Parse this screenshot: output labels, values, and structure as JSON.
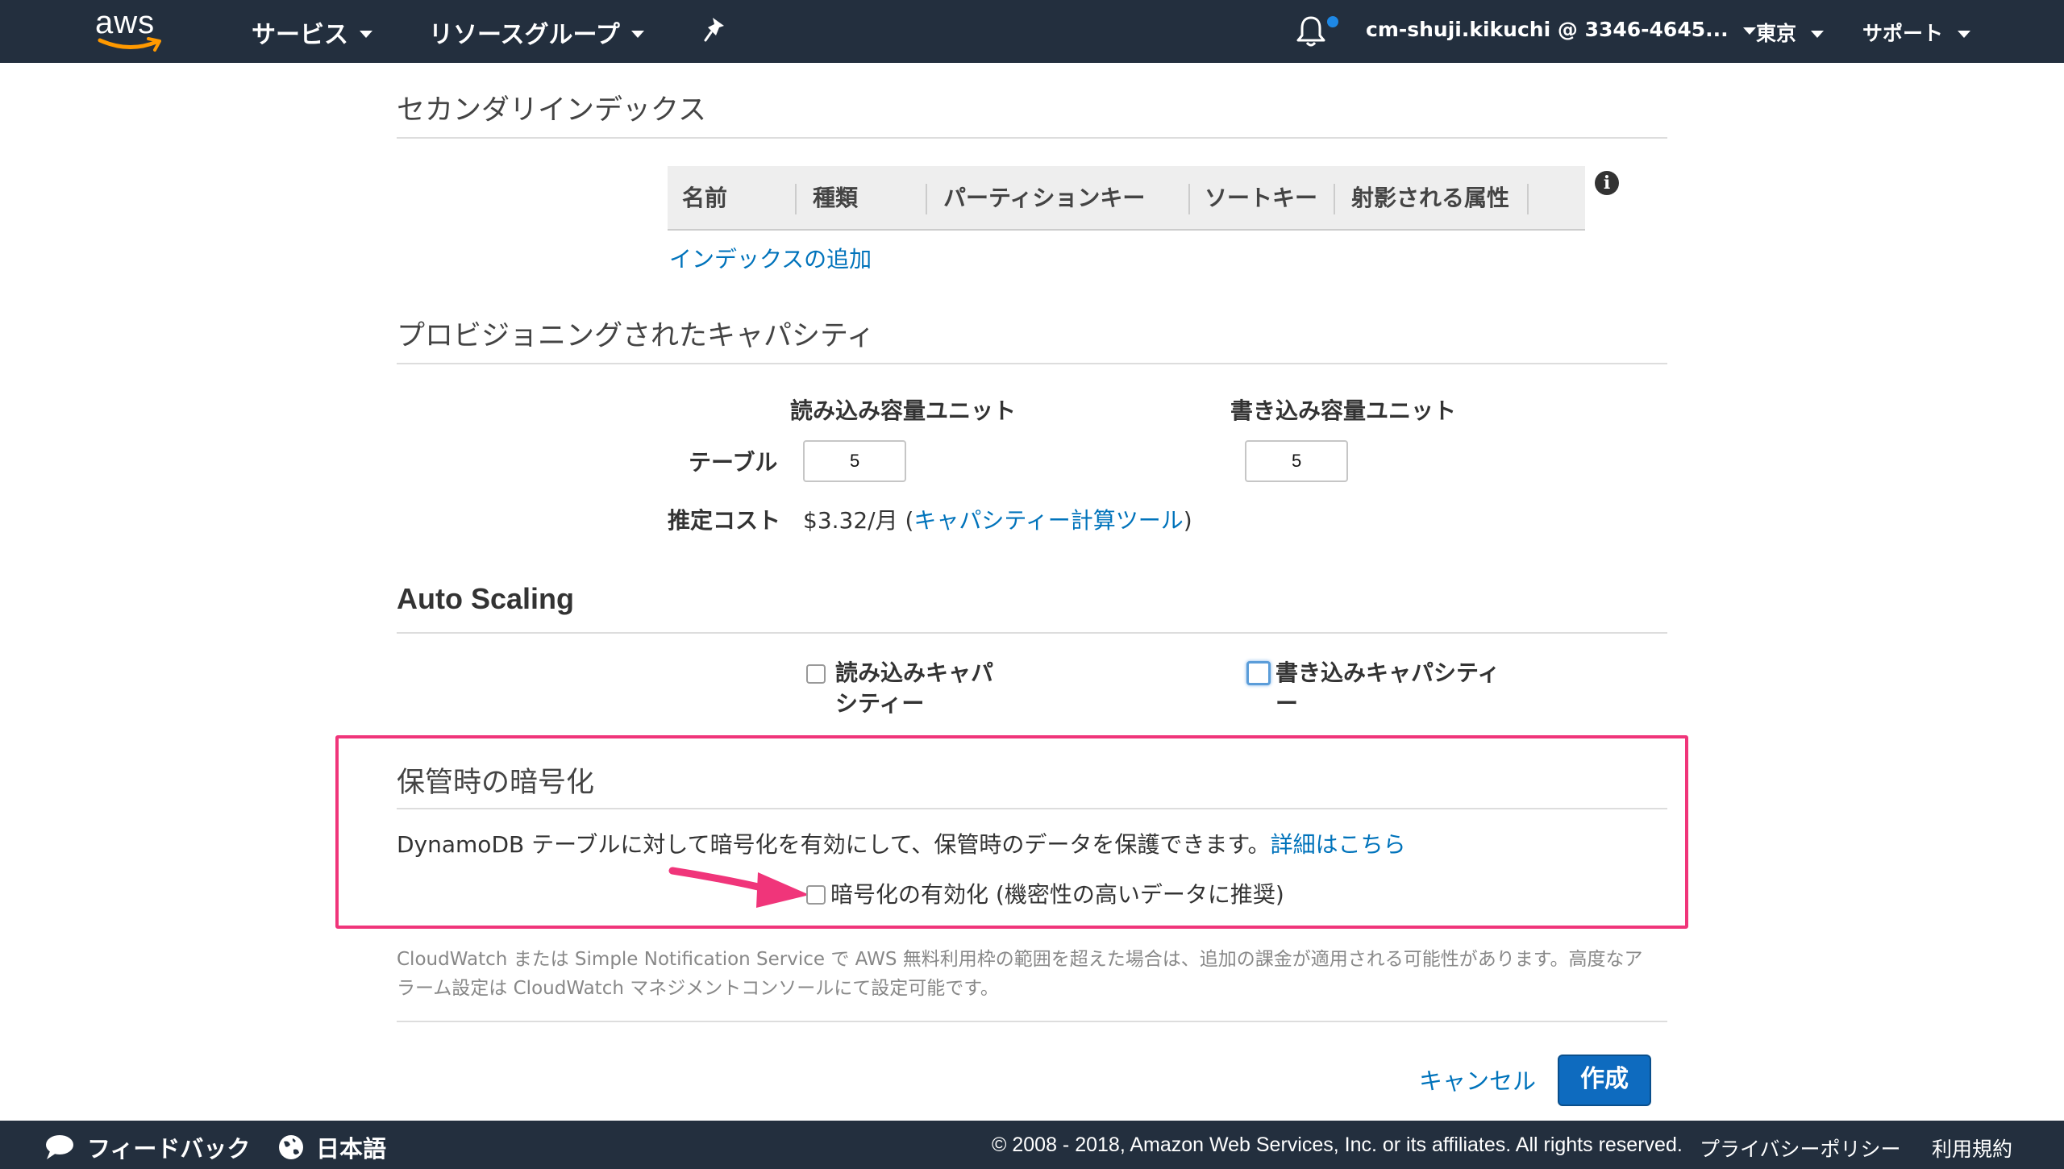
{
  "topnav": {
    "logo": "aws",
    "services": "サービス",
    "resource_groups": "リソースグループ",
    "account": "cm-shuji.kikuchi @ 3346-4645...",
    "region": "東京",
    "support": "サポート",
    "icons": [
      "pin-icon",
      "bell-icon"
    ]
  },
  "secondary_index": {
    "title": "セカンダリインデックス",
    "columns": [
      "名前",
      "種類",
      "パーティションキー",
      "ソートキー",
      "射影される属性"
    ],
    "add_index_link": "インデックスの追加"
  },
  "capacity": {
    "title": "プロビジョニングされたキャパシティ",
    "read_header": "読み込み容量ユニット",
    "write_header": "書き込み容量ユニット",
    "table_label": "テーブル",
    "read_value": "5",
    "write_value": "5",
    "cost_label": "推定コスト",
    "cost_value": "$3.32/月 (",
    "calculator_link": "キャパシティー計算ツール",
    "cost_close": ")"
  },
  "autoscaling": {
    "title": "Auto Scaling",
    "read_line1": "読み込みキャパ",
    "read_line2": "シティー",
    "write_line1": "書き込みキャパシティ",
    "write_line2": "ー"
  },
  "encryption": {
    "title": "保管時の暗号化",
    "description": "DynamoDB テーブルに対して暗号化を有効にして、保管時のデータを保護できます。",
    "details_link": "詳細はこちら",
    "checkbox_label": "暗号化の有効化 (機密性の高いデータに推奨)",
    "highlight_color": "#f0357a"
  },
  "note": {
    "line1": "CloudWatch または Simple Notification Service で AWS 無料利用枠の範囲を超えた場合は、追加の課金が適用される可能性があります。高度なア",
    "line2": "ラーム設定は CloudWatch マネジメントコンソールにて設定可能です。"
  },
  "actions": {
    "cancel": "キャンセル",
    "create": "作成"
  },
  "footer": {
    "feedback": "フィードバック",
    "language": "日本語",
    "copyright": "© 2008 - 2018, Amazon Web Services, Inc. or its affiliates. All rights reserved.",
    "privacy": "プライバシーポリシー",
    "terms": "利用規約"
  }
}
